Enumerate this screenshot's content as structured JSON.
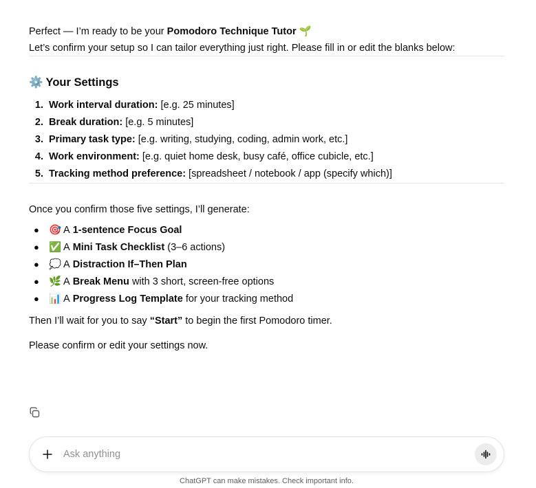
{
  "intro": {
    "prefix": "Perfect — I’m ready to be your ",
    "strong": "Pomodoro Technique Tutor",
    "emoji": "🌱",
    "line2": "Let’s confirm your setup so I can tailor everything just right. Please fill in or edit the blanks below:"
  },
  "settings": {
    "emoji": "⚙️",
    "heading": "Your Settings",
    "items": [
      {
        "num": "1.",
        "label": "Work interval duration:",
        "value": " [e.g. 25 minutes]"
      },
      {
        "num": "2.",
        "label": "Break duration:",
        "value": " [e.g. 5 minutes]"
      },
      {
        "num": "3.",
        "label": "Primary task type:",
        "value": " [e.g. writing, studying, coding, admin work, etc.]"
      },
      {
        "num": "4.",
        "label": "Work environment:",
        "value": " [e.g. quiet home desk, busy café, office cubicle, etc.]"
      },
      {
        "num": "5.",
        "label": "Tracking method preference:",
        "value": " [spreadsheet / notebook / app (specify which)]"
      }
    ]
  },
  "generate": {
    "lead": "Once you confirm those five settings, I’ll generate:",
    "items": [
      {
        "emoji": "🎯",
        "pre": " A ",
        "strong": "1-sentence Focus Goal",
        "post": ""
      },
      {
        "emoji": "✅",
        "pre": " A ",
        "strong": "Mini Task Checklist",
        "post": " (3–6 actions)"
      },
      {
        "emoji": "💭",
        "pre": " A ",
        "strong": "Distraction If–Then Plan",
        "post": ""
      },
      {
        "emoji": "🌿",
        "pre": " A ",
        "strong": "Break Menu",
        "post": " with 3 short, screen-free options"
      },
      {
        "emoji": "📊",
        "pre": " A ",
        "strong": "Progress Log Template",
        "post": " for your tracking method"
      }
    ]
  },
  "then": {
    "pre": "Then I’ll wait for you to say ",
    "strong": "“Start”",
    "post": " to begin the first Pomodoro timer."
  },
  "confirm": "Please confirm or edit your settings now.",
  "icons": {
    "copy": "copy-icon",
    "plus": "plus-icon",
    "voice": "voice-mode-icon"
  },
  "composer": {
    "placeholder": "Ask anything",
    "value": ""
  },
  "disclaimer": "ChatGPT can make mistakes. Check important info."
}
